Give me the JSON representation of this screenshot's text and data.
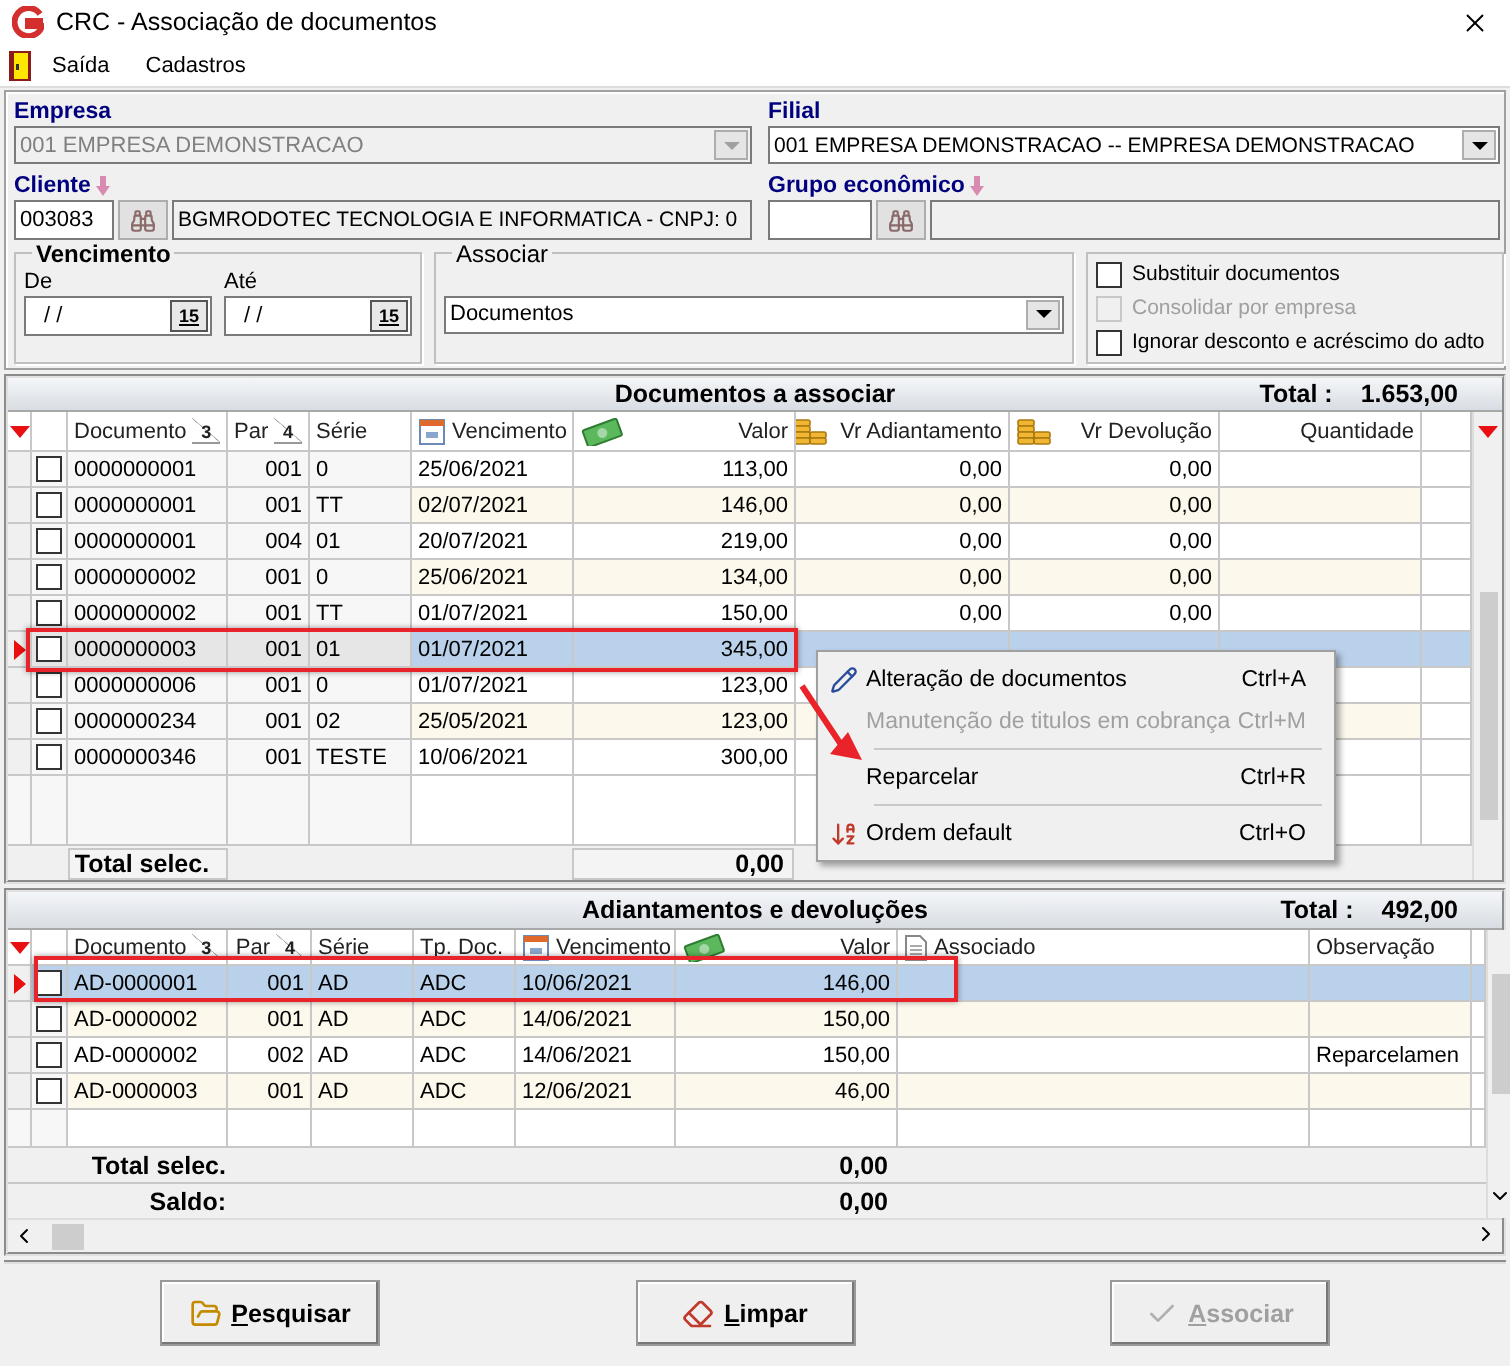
{
  "window": {
    "title": "CRC - Associação de documentos"
  },
  "menu": [
    {
      "label": "Saída"
    },
    {
      "label": "Cadastros"
    }
  ],
  "filters": {
    "empresa": {
      "label": "Empresa",
      "value": "001 EMPRESA DEMONSTRACAO",
      "disabled": true
    },
    "filial": {
      "label": "Filial",
      "value": "001 EMPRESA DEMONSTRACAO -- EMPRESA DEMONSTRACAO",
      "disabled": false
    },
    "cliente": {
      "label": "Cliente",
      "code": "003083",
      "name": "BGMRODOTEC TECNOLOGIA  E INFORMATICA - CNPJ: 0"
    },
    "grupo": {
      "label": "Grupo econômico"
    },
    "vencimento": {
      "label": "Vencimento",
      "fields": [
        {
          "label": "De",
          "value": " / /",
          "picker": "15"
        },
        {
          "label": "Até",
          "value": " / /",
          "picker": "15"
        }
      ]
    },
    "associar": {
      "label": "Associar",
      "value": "Documentos"
    },
    "options": [
      {
        "label": "Substituir documentos",
        "checked": false,
        "disabled": false
      },
      {
        "label": "Consolidar por empresa",
        "checked": false,
        "disabled": true
      },
      {
        "label": "Ignorar desconto e acréscimo do adto",
        "checked": false,
        "disabled": false
      }
    ]
  },
  "documents": {
    "title": "Documentos a associar",
    "total_label": "Total :",
    "total": "1.653,00",
    "columns": [
      {
        "label": "Documento",
        "sort": "3",
        "kind": "plain"
      },
      {
        "label": "Par",
        "sort": "4",
        "kind": "plain"
      },
      {
        "label": "Série",
        "kind": "plain"
      },
      {
        "label": "Vencimento",
        "kind": "date"
      },
      {
        "label": "Valor",
        "kind": "money"
      },
      {
        "label": "Vr Adiantamento",
        "kind": "coins"
      },
      {
        "label": "Vr Devolução",
        "kind": "coins"
      },
      {
        "label": "Quantidade",
        "kind": "plain"
      }
    ],
    "rows": [
      {
        "checked": false,
        "selected": false,
        "cells": [
          "0000000001",
          "001",
          "0",
          "25/06/2021",
          "113,00",
          "0,00",
          "0,00"
        ]
      },
      {
        "checked": false,
        "selected": false,
        "cells": [
          "0000000001",
          "001",
          "TT",
          "02/07/2021",
          "146,00",
          "0,00",
          "0,00"
        ]
      },
      {
        "checked": false,
        "selected": false,
        "cells": [
          "0000000001",
          "004",
          "01",
          "20/07/2021",
          "219,00",
          "0,00",
          "0,00"
        ]
      },
      {
        "checked": false,
        "selected": false,
        "cells": [
          "0000000002",
          "001",
          "0",
          "25/06/2021",
          "134,00",
          "0,00",
          "0,00"
        ]
      },
      {
        "checked": false,
        "selected": false,
        "cells": [
          "0000000002",
          "001",
          "TT",
          "01/07/2021",
          "150,00",
          "0,00",
          "0,00"
        ]
      },
      {
        "checked": false,
        "selected": true,
        "cells": [
          "0000000003",
          "001",
          "01",
          "01/07/2021",
          "345,00"
        ]
      },
      {
        "checked": false,
        "selected": false,
        "cells": [
          "0000000006",
          "001",
          "0",
          "01/07/2021",
          "123,00"
        ]
      },
      {
        "checked": false,
        "selected": false,
        "cells": [
          "0000000234",
          "001",
          "02",
          "25/05/2021",
          "123,00"
        ]
      },
      {
        "checked": false,
        "selected": false,
        "cells": [
          "0000000346",
          "001",
          "TESTE",
          "10/06/2021",
          "300,00"
        ]
      }
    ],
    "footer": [
      {
        "label": "Total selec.",
        "value": "0,00"
      }
    ]
  },
  "advances": {
    "title": "Adiantamentos e devoluções",
    "total_label": "Total :",
    "total": "492,00",
    "columns": [
      {
        "label": "Documento",
        "sort": "3",
        "kind": "plain"
      },
      {
        "label": "Par",
        "sort": "4",
        "kind": "plain"
      },
      {
        "label": "Série",
        "kind": "plain"
      },
      {
        "label": "Tp. Doc.",
        "kind": "plain"
      },
      {
        "label": "Vencimento",
        "kind": "date"
      },
      {
        "label": "Valor",
        "kind": "money"
      },
      {
        "label": "Associado",
        "kind": "note"
      },
      {
        "label": "Observação",
        "kind": "plain"
      }
    ],
    "rows": [
      {
        "checked": false,
        "selected": true,
        "cells": [
          "AD-0000001",
          "001",
          "AD",
          "ADC",
          "10/06/2021",
          "146,00"
        ]
      },
      {
        "checked": false,
        "selected": false,
        "cells": [
          "AD-0000002",
          "001",
          "AD",
          "ADC",
          "14/06/2021",
          "150,00"
        ]
      },
      {
        "checked": false,
        "selected": false,
        "cells": [
          "AD-0000002",
          "002",
          "AD",
          "ADC",
          "14/06/2021",
          "150,00",
          null,
          "Reparcelamen"
        ]
      },
      {
        "checked": false,
        "selected": false,
        "cells": [
          "AD-0000003",
          "001",
          "AD",
          "ADC",
          "12/06/2021",
          "46,00"
        ]
      }
    ],
    "footer": [
      {
        "label": "Total selec.",
        "value": "0,00"
      },
      {
        "label": "Saldo:",
        "value": "0,00"
      }
    ]
  },
  "context_menu": [
    {
      "kind": "item",
      "label": "Alteração de documentos",
      "shortcut": "Ctrl+A",
      "disabled": false
    },
    {
      "kind": "item",
      "label": "Manutenção de titulos em cobrança",
      "shortcut": "Ctrl+M",
      "disabled": true
    },
    {
      "kind": "separator"
    },
    {
      "kind": "item",
      "label": "Reparcelar",
      "shortcut": "Ctrl+R",
      "disabled": false
    },
    {
      "kind": "separator"
    },
    {
      "kind": "item",
      "label": "Ordem default",
      "shortcut": "Ctrl+O",
      "disabled": false
    }
  ],
  "markup": [
    {
      "kind": "frame"
    },
    {
      "kind": "frame"
    },
    {
      "kind": "arrow"
    }
  ],
  "buttons": [
    {
      "label": "Pesquisar",
      "disabled": false
    },
    {
      "label": "Limpar",
      "disabled": false
    },
    {
      "label": "Associar",
      "disabled": true
    }
  ]
}
